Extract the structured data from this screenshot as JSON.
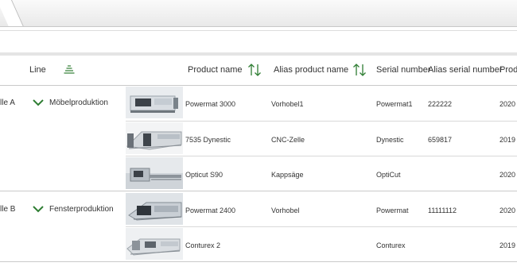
{
  "header": {
    "line_label": "Line",
    "product_name": "Product name",
    "alias_product_name": "Alias product name",
    "serial_number": "Serial number",
    "alias_serial_number": "Alias serial number",
    "production_truncated": "Prod"
  },
  "icons": {
    "filter": "list-filter-icon",
    "sort": "sort-up-down-icon",
    "expand": "chevron-down-icon",
    "accent_color": "#2e7d32"
  },
  "groups": [
    {
      "cell_label": "lle A",
      "line": "Möbelproduktion",
      "rows": [
        {
          "product": "Powermat 3000",
          "alias": "Vorhobel1",
          "serial": "Powermat1",
          "alias_serial": "222222",
          "year": "2020"
        },
        {
          "product": "7535 Dynestic",
          "alias": "CNC-Zelle",
          "serial": "Dynestic",
          "alias_serial": "659817",
          "year": "2019"
        },
        {
          "product": "Opticut S90",
          "alias": "Kappsäge",
          "serial": "OptiCut",
          "alias_serial": "",
          "year": "2020"
        }
      ]
    },
    {
      "cell_label": "lle B",
      "line": "Fensterproduktion",
      "rows": [
        {
          "product": "Powermat 2400",
          "alias": "Vorhobel",
          "serial": "Powermat",
          "alias_serial": "11111112",
          "year": "2020"
        },
        {
          "product": "Conturex 2",
          "alias": "",
          "serial": "Conturex",
          "alias_serial": "",
          "year": "2019"
        }
      ]
    }
  ]
}
